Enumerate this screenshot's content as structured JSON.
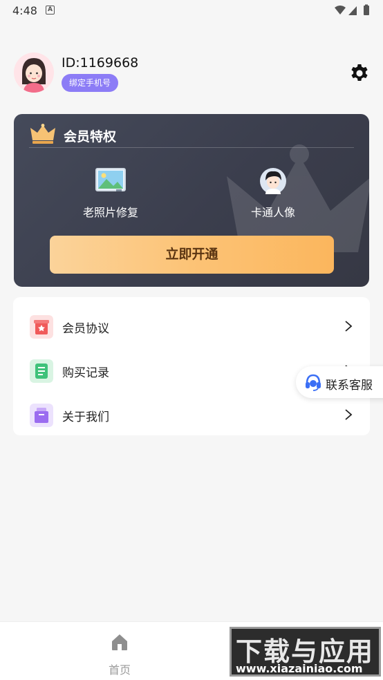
{
  "status_bar": {
    "time": "4:48",
    "notification_badge": "A"
  },
  "profile": {
    "user_id": "ID:1169668",
    "bind_phone_label": "绑定手机号"
  },
  "vip": {
    "title": "会员特权",
    "features": [
      {
        "label": "老照片修复",
        "icon": "photo-icon"
      },
      {
        "label": "卡通人像",
        "icon": "cartoon-avatar-icon"
      }
    ],
    "open_button_label": "立即开通",
    "colors": {
      "button_start": "#fbd39a",
      "button_end": "#fbb65d",
      "card_bg": "#3f4251"
    }
  },
  "menu": {
    "items": [
      {
        "label": "会员协议",
        "icon": "agreement-icon",
        "color": "#f05a5a"
      },
      {
        "label": "购买记录",
        "icon": "record-icon",
        "color": "#3fc27a"
      },
      {
        "label": "关于我们",
        "icon": "about-icon",
        "color": "#9b6cf0"
      }
    ]
  },
  "contact": {
    "label": "联系客服"
  },
  "bottom_nav": {
    "home_label": "首页"
  },
  "watermark": {
    "top": "下载与应用",
    "bottom": "www.xiazainiao.com"
  }
}
